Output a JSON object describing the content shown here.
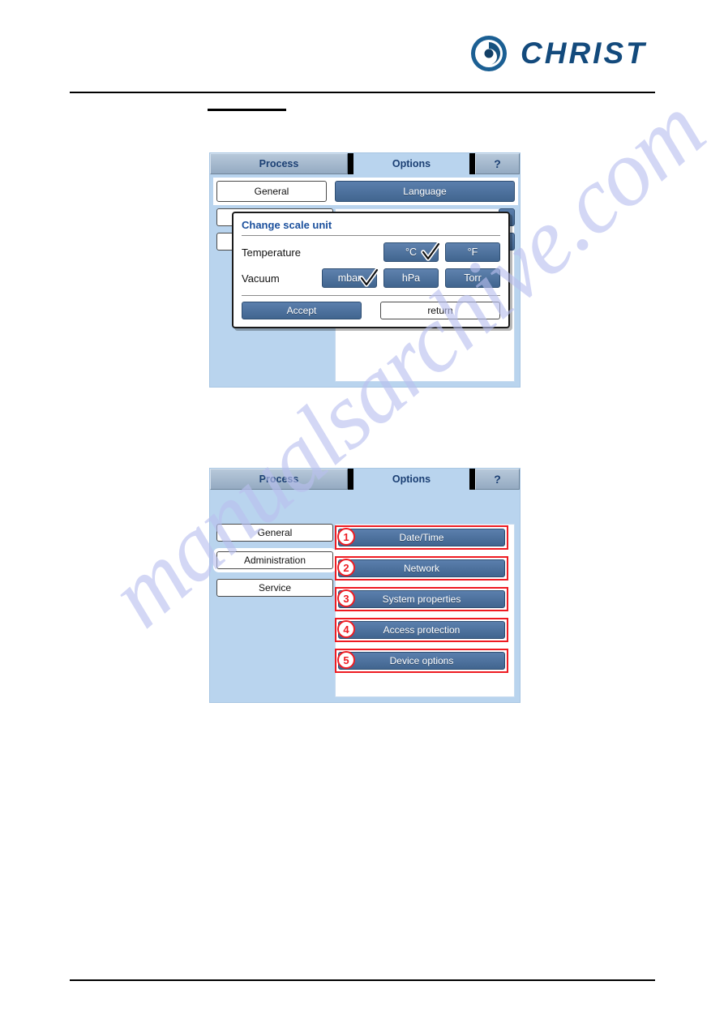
{
  "brand": {
    "name": "CHRIST",
    "logo_icon": "christ-spiral-logo-icon",
    "color": "#134a7c"
  },
  "watermark": {
    "text": "manualsarchive.com",
    "color": "#b9c0ef"
  },
  "screenshot_1": {
    "tabs": {
      "process": "Process",
      "options": "Options",
      "help": "?"
    },
    "top_buttons": {
      "general": "General",
      "language": "Language"
    },
    "dialog": {
      "title": "Change scale unit",
      "rows": [
        {
          "label": "Temperature",
          "units": [
            {
              "label": "°C",
              "checked": true
            },
            {
              "label": "°F",
              "checked": false
            }
          ]
        },
        {
          "label": "Vacuum",
          "units": [
            {
              "label": "mbar",
              "checked": true
            },
            {
              "label": "hPa",
              "checked": false
            },
            {
              "label": "Torr",
              "checked": false
            }
          ]
        }
      ],
      "accept_label": "Accept",
      "return_label": "return"
    }
  },
  "screenshot_2": {
    "tabs": {
      "process": "Process",
      "options": "Options",
      "help": "?"
    },
    "left_buttons": [
      {
        "label": "General",
        "selected": false
      },
      {
        "label": "Administration",
        "selected": true
      },
      {
        "label": "Service",
        "selected": false
      }
    ],
    "options": [
      {
        "number": "1",
        "label": "Date/Time"
      },
      {
        "number": "2",
        "label": "Network"
      },
      {
        "number": "3",
        "label": "System properties"
      },
      {
        "number": "4",
        "label": "Access protection"
      },
      {
        "number": "5",
        "label": "Device options"
      }
    ],
    "callout_color": "#ee1b22"
  }
}
